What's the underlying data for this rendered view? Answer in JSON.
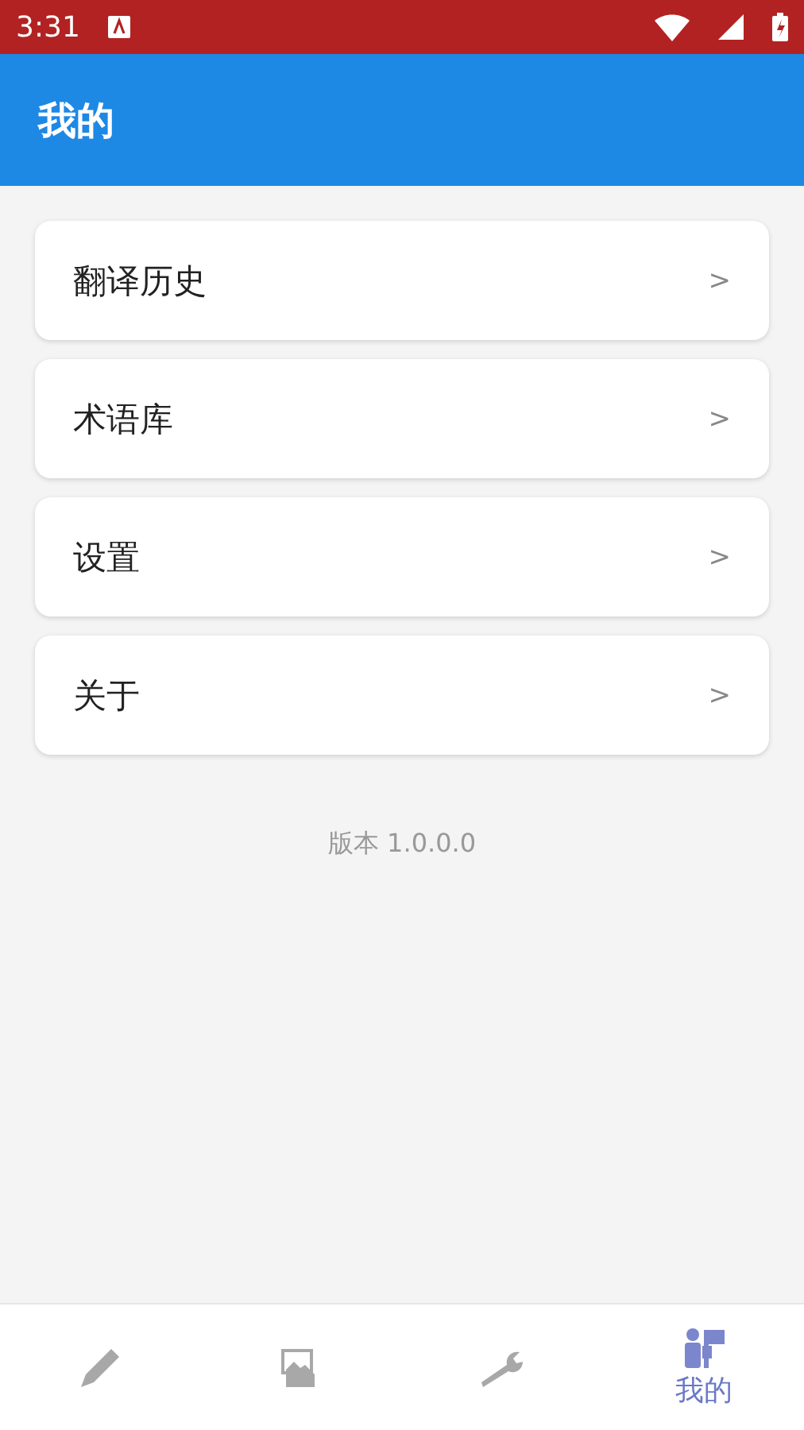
{
  "status_bar": {
    "time": "3:31"
  },
  "app_bar": {
    "title": "我的"
  },
  "menu": [
    {
      "label": "翻译历史",
      "chevron": ">"
    },
    {
      "label": "术语库",
      "chevron": ">"
    },
    {
      "label": "设置",
      "chevron": ">"
    },
    {
      "label": "关于",
      "chevron": ">"
    }
  ],
  "version": "版本 1.0.0.0",
  "tabs": [
    {
      "kind": "pencil",
      "selected": false
    },
    {
      "kind": "image",
      "selected": false
    },
    {
      "kind": "wrench",
      "selected": false
    },
    {
      "kind": "people",
      "label": "我的",
      "selected": true
    }
  ]
}
